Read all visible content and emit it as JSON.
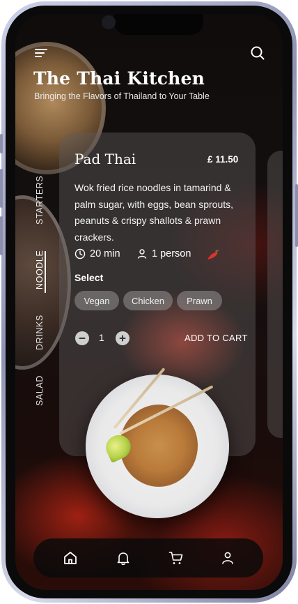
{
  "header": {
    "title": "The Thai Kitchen",
    "subtitle": "Bringing the Flavors of Thailand to Your Table",
    "icons": [
      "menu-icon",
      "search-icon"
    ]
  },
  "categories": [
    {
      "label": "STARTERS",
      "active": false
    },
    {
      "label": "NOODLE",
      "active": true
    },
    {
      "label": "DRINKS",
      "active": false
    },
    {
      "label": "SALAD",
      "active": false
    }
  ],
  "dish": {
    "name": "Pad Thai",
    "price": "£ 11.50",
    "description": "Wok fried rice noodles in tamarind & palm sugar, with eggs, bean sprouts, peanuts & crispy shallots & prawn crackers.",
    "time": "20 min",
    "serves": "1 person",
    "spicy_icon": "chili-icon",
    "select_label": "Select",
    "options": [
      "Vegan",
      "Chicken",
      "Prawn"
    ],
    "quantity": "1",
    "add_to_cart": "ADD TO CART"
  },
  "bottom_nav": {
    "items": [
      "home-icon",
      "bell-icon",
      "cart-icon",
      "user-icon"
    ]
  },
  "colors": {
    "accent_red": "#e0322a",
    "card_bg": "#5f5a5a"
  }
}
